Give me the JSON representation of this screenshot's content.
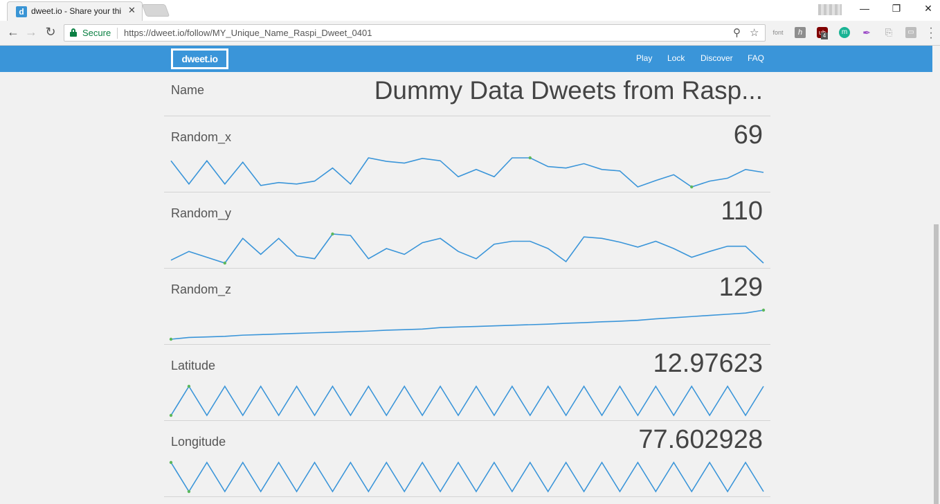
{
  "browser": {
    "tab_title": "dweet.io - Share your thi",
    "tab_favicon": "d",
    "tab_close": "✕",
    "window": {
      "minimize": "—",
      "maximize": "❐",
      "close": "✕"
    },
    "secure_label": "Secure",
    "url": "https://dweet.io/follow/MY_Unique_Name_Raspi_Dweet_0401",
    "nav_icons": [
      "back-icon",
      "forward-icon",
      "reload-icon"
    ],
    "extensions": [
      "font",
      "h",
      "ub",
      "m",
      "quill-icon",
      "pdf-icon",
      "box-icon"
    ],
    "ext_ub_badge": "4"
  },
  "site": {
    "brand": "dweet.io",
    "nav": [
      "Play",
      "Lock",
      "Discover",
      "FAQ"
    ],
    "accent_color": "#3a95d9"
  },
  "name_row": {
    "label": "Name",
    "value": "Dummy Data Dweets from Rasp..."
  },
  "metrics": [
    {
      "label": "Random_x",
      "value": "69"
    },
    {
      "label": "Random_y",
      "value": "110"
    },
    {
      "label": "Random_z",
      "value": "129"
    },
    {
      "label": "Latitude",
      "value": "12.97623"
    },
    {
      "label": "Longitude",
      "value": "77.602928"
    }
  ],
  "chart_data": [
    {
      "type": "line",
      "series": [
        {
          "values": [
            0.9,
            0.1,
            0.9,
            0.1,
            0.85,
            0.05,
            0.15,
            0.1,
            0.2,
            0.65,
            0.1,
            1.0,
            0.88,
            0.82,
            0.98,
            0.9,
            0.35,
            0.6,
            0.35,
            1.0,
            1.0,
            0.7,
            0.65,
            0.8,
            0.6,
            0.55,
            0.0,
            0.22,
            0.42,
            0.0,
            0.2,
            0.3,
            0.6,
            0.5
          ]
        }
      ],
      "min_index": 29,
      "max_index": 20,
      "line_color": "#3a95d9",
      "marker_color": "#5cb85c"
    },
    {
      "type": "line",
      "series": [
        {
          "values": [
            0.1,
            0.4,
            0.2,
            0.0,
            0.85,
            0.3,
            0.85,
            0.25,
            0.15,
            1.0,
            0.95,
            0.15,
            0.5,
            0.3,
            0.7,
            0.85,
            0.4,
            0.15,
            0.65,
            0.75,
            0.75,
            0.5,
            0.05,
            0.9,
            0.85,
            0.72,
            0.55,
            0.75,
            0.5,
            0.2,
            0.4,
            0.58,
            0.58,
            0.0
          ]
        }
      ],
      "min_index": 3,
      "max_index": 9,
      "line_color": "#3a95d9",
      "marker_color": "#5cb85c"
    },
    {
      "type": "line",
      "series": [
        {
          "values": [
            0.0,
            0.06,
            0.08,
            0.1,
            0.14,
            0.16,
            0.18,
            0.2,
            0.22,
            0.24,
            0.26,
            0.28,
            0.31,
            0.33,
            0.35,
            0.4,
            0.42,
            0.44,
            0.46,
            0.48,
            0.5,
            0.52,
            0.55,
            0.57,
            0.6,
            0.62,
            0.65,
            0.7,
            0.74,
            0.78,
            0.82,
            0.86,
            0.9,
            1.0
          ]
        }
      ],
      "min_index": 0,
      "max_index": 33,
      "line_color": "#3a95d9",
      "marker_color": "#5cb85c"
    },
    {
      "type": "line",
      "series": [
        {
          "values": [
            0,
            1,
            0,
            1,
            0,
            1,
            0,
            1,
            0,
            1,
            0,
            1,
            0,
            1,
            0,
            1,
            0,
            1,
            0,
            1,
            0,
            1,
            0,
            1,
            0,
            1,
            0,
            1,
            0,
            1,
            0,
            1,
            0,
            1
          ]
        }
      ],
      "min_index": 0,
      "max_index": 1,
      "line_color": "#3a95d9",
      "marker_color": "#5cb85c"
    },
    {
      "type": "line",
      "series": [
        {
          "values": [
            1,
            0,
            1,
            0,
            1,
            0,
            1,
            0,
            1,
            0,
            1,
            0,
            1,
            0,
            1,
            0,
            1,
            0,
            1,
            0,
            1,
            0,
            1,
            0,
            1,
            0,
            1,
            0,
            1,
            0,
            1,
            0,
            1,
            0
          ]
        }
      ],
      "min_index": 1,
      "max_index": 0,
      "line_color": "#3a95d9",
      "marker_color": "#5cb85c"
    }
  ]
}
